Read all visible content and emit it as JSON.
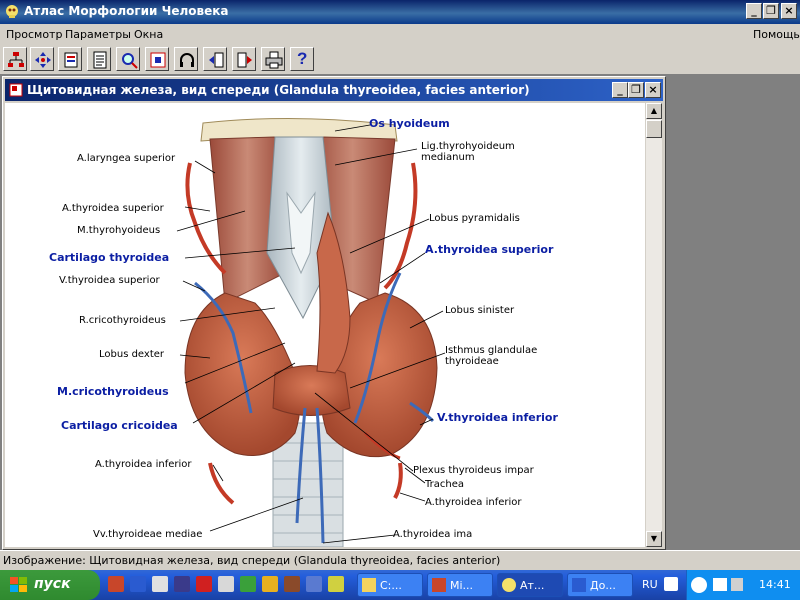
{
  "app": {
    "title": "Атлас Морфологии Человека",
    "controls": {
      "minimize": "_",
      "restore": "❐",
      "close": "×"
    }
  },
  "menu": {
    "left": [
      "Просмотр",
      "Параметры",
      "Окна"
    ],
    "right": "Помощь"
  },
  "toolbar": {
    "buttons": [
      "tree-icon",
      "navigate-icon",
      "index-icon",
      "document-icon",
      "search-icon",
      "grid-icon",
      "headphones-icon",
      "back-icon",
      "forward-icon",
      "print-icon",
      "help-icon"
    ],
    "help_glyph": "?"
  },
  "image_window": {
    "title": "Щитовидная железа, вид спереди (Glandula thyreoidea, facies anterior)",
    "controls": {
      "minimize": "_",
      "restore": "❐",
      "close": "×"
    }
  },
  "labels": {
    "os_hyoideum": "Os hyoideum",
    "a_laryngea_superior": "A.laryngea superior",
    "lig_thyrohyoideum": "Lig.thyrohyoideum",
    "medianum": "medianum",
    "a_thyroidea_superior_left": "A.thyroidea superior",
    "lobus_pyramidalis": "Lobus pyramidalis",
    "m_thyrohyoideus": "M.thyrohyoideus",
    "a_thyroidea_superior_right": "A.thyroidea superior",
    "cartilago_thyroidea": "Cartilago thyroidea",
    "v_thyroidea_superior": "V.thyroidea superior",
    "lobus_sinister": "Lobus sinister",
    "r_cricothyroideus": "R.cricothyroideus",
    "isthmus_glandulae": "Isthmus glandulae",
    "thyroideae": "thyroideae",
    "lobus_dexter": "Lobus dexter",
    "m_cricothyroideus": "M.cricothyroideus",
    "v_thyroidea_inferior": "V.thyroidea inferior",
    "cartilago_cricoidea": "Cartilago cricoidea",
    "a_thyroidea_inferior_left": "A.thyroidea inferior",
    "plexus_thyroideus_impar": "Plexus thyroideus impar",
    "trachea": "Trachea",
    "a_thyroidea_inferior_right": "A.thyroidea inferior",
    "vv_thyroideae_mediae": "Vv.thyroideae mediae",
    "a_thyroidea_ima": "A.thyroidea ima"
  },
  "status": {
    "text": "Изображение: Щитовидная железа, вид спереди (Glandula thyreoidea, facies anterior)"
  },
  "taskbar": {
    "start_label": "пуск",
    "tasks": [
      {
        "label": "C:...",
        "active": false
      },
      {
        "label": "Mi...",
        "active": false
      },
      {
        "label": "Ат...",
        "active": true
      },
      {
        "label": "До...",
        "active": false
      }
    ],
    "lang": "RU",
    "clock": "14:41"
  },
  "colors": {
    "title_blue": "#0a246a",
    "label_blue": "#0b1ea3",
    "gland": "#c8684a",
    "muscle": "#b86a58",
    "cartilage": "#c9d4d8",
    "artery": "#c43a26",
    "vein": "#3d6ab8"
  }
}
